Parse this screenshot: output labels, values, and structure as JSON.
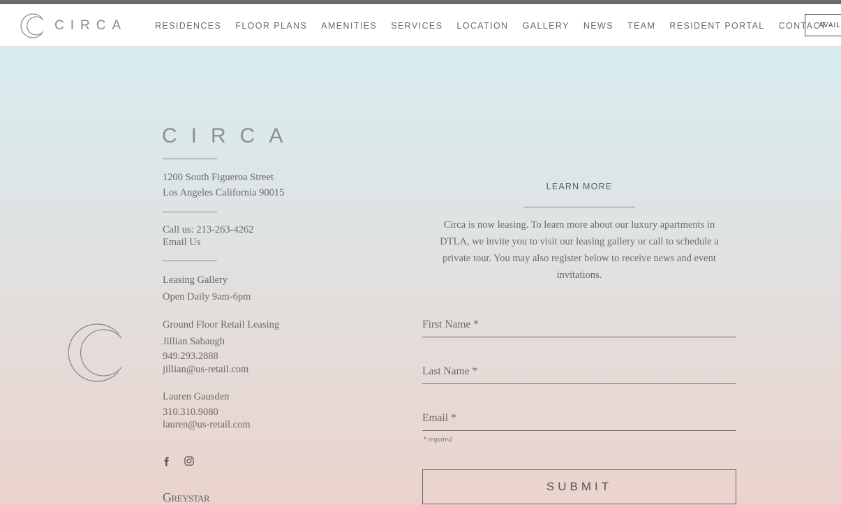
{
  "header": {
    "logo_text": "CIRCA",
    "nav": [
      "RESIDENCES",
      "FLOOR PLANS",
      "AMENITIES",
      "SERVICES",
      "LOCATION",
      "GALLERY",
      "NEWS",
      "TEAM",
      "RESIDENT PORTAL",
      "CONTACT"
    ],
    "availability_label": "AVAILABILITY"
  },
  "footer_info": {
    "wordmark": "CIRCA",
    "address_line1": "1200 South Figueroa Street",
    "address_line2": "Los Angeles California 90015",
    "phone": "Call us: 213-263-4262",
    "email_link": "Email Us",
    "leasing_title": "Leasing Gallery",
    "leasing_hours": "Open Daily 9am-6pm",
    "retail_title": "Ground Floor Retail Leasing",
    "contact1_name": "Jillian Sabaugh",
    "contact1_phone": "949.293.2888",
    "contact1_email": "jillian@us-retail.com",
    "contact2_name": "Lauren Gausden",
    "contact2_phone": "310.310.9080",
    "contact2_email": "lauren@us-retail.com",
    "greystar": "Greystar"
  },
  "form": {
    "learn_more": "LEARN MORE",
    "intro": "Circa is now leasing. To learn more about our luxury apartments in DTLA, we invite you to visit our leasing gallery or call to schedule a private tour. You may also register below to receive news and event invitations.",
    "first_name_placeholder": "First Name *",
    "last_name_placeholder": "Last Name *",
    "email_placeholder": "Email *",
    "required_note": "* required",
    "submit_label": "SUBMIT"
  },
  "icons": [
    "circa-c-logo-icon",
    "facebook-icon",
    "instagram-icon"
  ],
  "colors": {
    "header_bg": "#ffffff",
    "text": "#6a6a6a",
    "gradient_top": "#d6eff2",
    "gradient_bottom": "#ebd3cc"
  }
}
